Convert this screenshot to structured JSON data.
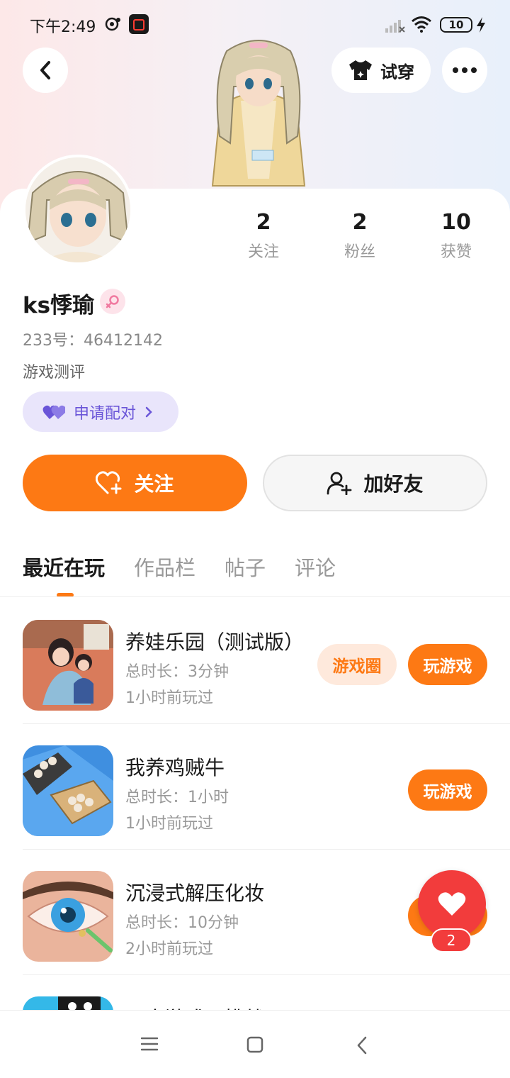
{
  "status_bar": {
    "time": "下午2:49",
    "battery": "10"
  },
  "header": {
    "try_on_label": "试穿"
  },
  "profile": {
    "stats": [
      {
        "value": "2",
        "label": "关注"
      },
      {
        "value": "2",
        "label": "粉丝"
      },
      {
        "value": "10",
        "label": "获赞"
      }
    ],
    "name": "ks悸瑜",
    "uid": "233号：46412142",
    "bio": "游戏测评",
    "pair_label": "申请配对",
    "follow_label": "关注",
    "add_friend_label": "加好友"
  },
  "tabs": [
    {
      "label": "最近在玩",
      "active": true
    },
    {
      "label": "作品栏",
      "active": false
    },
    {
      "label": "帖子",
      "active": false
    },
    {
      "label": "评论",
      "active": false
    }
  ],
  "games": [
    {
      "name": "养娃乐园（测试版）",
      "duration": "总时长：3分钟",
      "last_played": "1小时前玩过",
      "circle_label": "游戏圈",
      "play_label": "玩游戏"
    },
    {
      "name": "我养鸡贼牛",
      "duration": "总时长：1小时",
      "last_played": "1小时前玩过",
      "play_label": "玩游戏"
    },
    {
      "name": "沉浸式解压化妆",
      "duration": "总时长：10分钟",
      "last_played": "2小时前玩过",
      "play_label": "玩游戏"
    },
    {
      "name": "双人游戏：挑战"
    }
  ],
  "like_badge": "2",
  "colors": {
    "accent": "#fd7914",
    "pair_purple": "#6a55d8",
    "like_red": "#f23c3c"
  }
}
